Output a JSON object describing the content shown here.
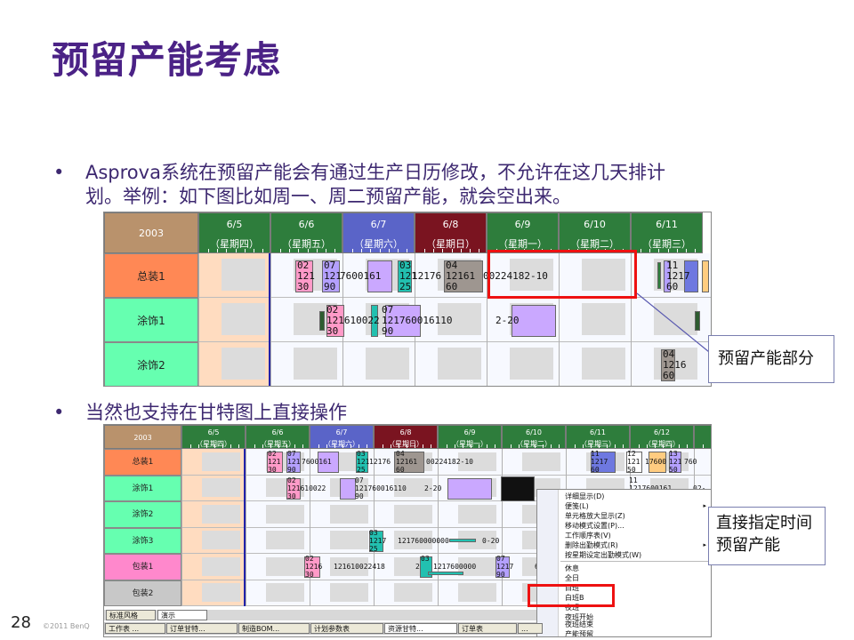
{
  "title": "预留产能考虑",
  "bullets": [
    {
      "marker": "•",
      "lines": [
        "Asprova系统在预留产能会有通过生产日历修改，不允许在这几天排计",
        "划。举例：如下图比如周一、周二预留产能，就会空出来。"
      ]
    },
    {
      "marker": "•",
      "lines": [
        "当然也支持在甘特图上直接操作"
      ]
    }
  ],
  "gantt1": {
    "year": "2003",
    "dates": [
      {
        "date": "6/5",
        "day": "（星期四）"
      },
      {
        "date": "6/6",
        "day": "（星期五）"
      },
      {
        "date": "6/7",
        "day": "（星期六）"
      },
      {
        "date": "6/8",
        "day": "（星期日）"
      },
      {
        "date": "6/9",
        "day": "（星期一）"
      },
      {
        "date": "6/10",
        "day": "（星期二）"
      },
      {
        "date": "6/11",
        "day": "（星期三）"
      }
    ],
    "resources": [
      "总装1",
      "涂饰1",
      "涂饰2"
    ],
    "texts": [
      "02",
      "121",
      "30",
      "07",
      "121",
      "90",
      "7600161",
      "03",
      "121",
      "25",
      "12176",
      "04",
      "12161",
      "60",
      "00224182-10",
      "11",
      "1217",
      "60",
      "02",
      "121610022",
      "30",
      "07",
      "121760016110",
      "90",
      "2-20",
      "04",
      "1216",
      "60"
    ],
    "colors": {
      "day_weekday": "#2e7d3c",
      "day_saturday": "#5a64c8",
      "day_sunday": "#7a1420",
      "year": "#b9926c",
      "assembly": "#ff8855",
      "coating": "#66ffb0"
    }
  },
  "callout1": "预留产能部分",
  "gantt2": {
    "year": "2003",
    "dates": [
      {
        "date": "6/5",
        "day": "（星期四）"
      },
      {
        "date": "6/6",
        "day": "（星期五）"
      },
      {
        "date": "6/7",
        "day": "（星期六）"
      },
      {
        "date": "6/8",
        "day": "（星期日）"
      },
      {
        "date": "6/9",
        "day": "（星期一）"
      },
      {
        "date": "6/10",
        "day": "（星期二）"
      },
      {
        "date": "6/11",
        "day": "（星期三）"
      },
      {
        "date": "6/12",
        "day": "（星期四）"
      },
      {
        "date": "6/",
        "day": "（星"
      }
    ],
    "resources": [
      "总装1",
      "涂饰1",
      "涂饰2",
      "涂饰3",
      "包装1",
      "包装2"
    ],
    "texts": [
      "02",
      "121",
      "30",
      "07",
      "121",
      "90",
      "7600161",
      "03",
      "121",
      "25",
      "12176",
      "04",
      "12161",
      "60",
      "00224182-10",
      "11",
      "1217",
      "60",
      "12",
      "121",
      "50",
      "17600",
      "13",
      "121",
      "50",
      "760",
      "02",
      "121610022",
      "30",
      "07",
      "121760016110",
      "90",
      "2-20",
      "11",
      "1217600161",
      "02-",
      "03",
      "1217",
      "25",
      "121760000000",
      "0-20",
      "02",
      "1216",
      "30",
      "121610022418",
      "2",
      "03",
      "1217600000",
      "07",
      "1217",
      "90",
      "6"
    ],
    "menu": [
      "详细显示(D)",
      "便笺(L)",
      "单元格放大显示(Z)",
      "移动模式设置(P)...",
      "工作顺序表(V)",
      "删除出勤模式(R)",
      "按星期设定出勤模式(W)",
      "休息",
      "全日",
      "白班",
      "白班B",
      "夜班",
      "夜班结束",
      "产能预留"
    ],
    "menu_covered": "夜班开始",
    "bottom_tabs": [
      "标准风格",
      "演示"
    ],
    "window_tabs": [
      "工作表 ...",
      "订单甘特...",
      "制造BOM...",
      "计划参数表",
      "资源甘特...",
      "订单表",
      "..."
    ]
  },
  "callout2": [
    "直接指定时间",
    "预留产能"
  ],
  "page_number": "28",
  "copyright": "©2011 BenQ"
}
